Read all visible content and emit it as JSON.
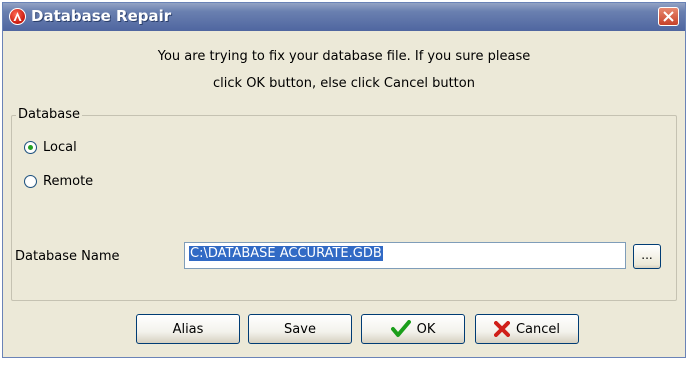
{
  "window": {
    "title": "Database Repair"
  },
  "message": {
    "line1": "You are trying to fix your database file. If you sure please",
    "line2": "click OK button, else click Cancel button"
  },
  "database_group": {
    "label": "Database",
    "options": [
      {
        "label": "Local",
        "checked": true
      },
      {
        "label": "Remote",
        "checked": false
      }
    ],
    "name_label": "Database Name",
    "name_value": "C:\\DATABASE ACCURATE.GDB",
    "browse_label": "..."
  },
  "buttons": {
    "alias": "Alias",
    "save": "Save",
    "ok": "OK",
    "cancel": "Cancel"
  },
  "colors": {
    "title_bar": "#6a80b0",
    "ok_icon": "#1a9e1a",
    "cancel_icon": "#d0201a"
  },
  "icons": {
    "app": "accurate-logo-icon",
    "close": "close-icon",
    "ok": "checkmark-icon",
    "cancel": "x-icon"
  }
}
